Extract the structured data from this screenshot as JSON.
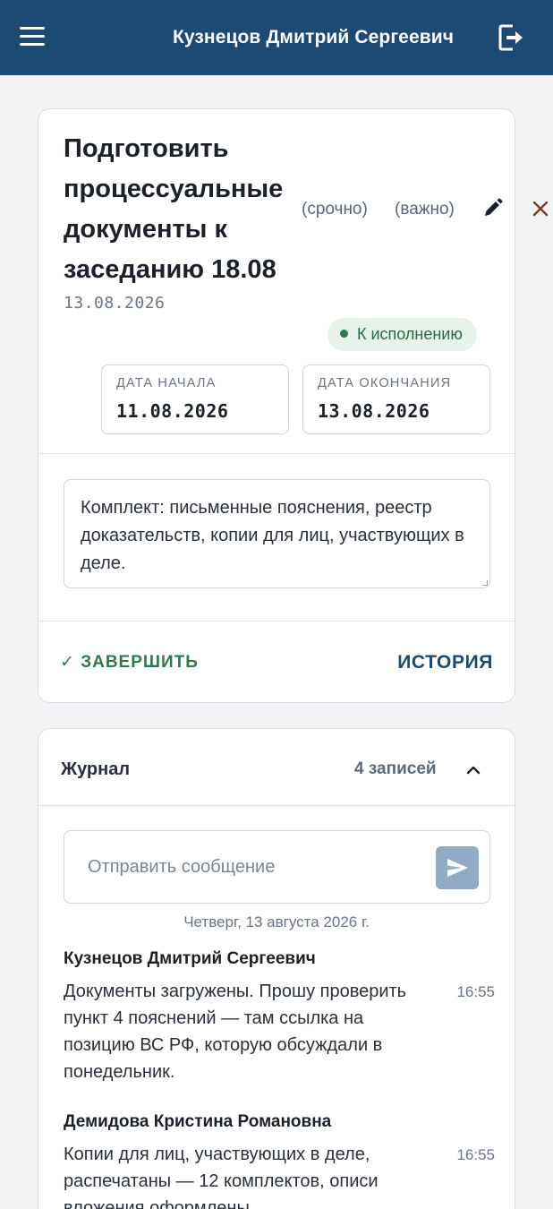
{
  "header": {
    "user_name": "Кузнецов Дмитрий Сергеевич",
    "menu_icon": "hamburger-menu-icon",
    "logout_icon": "logout-icon",
    "background_color": "#1c4a72"
  },
  "task": {
    "title": "Подготовить процессуальные документы к заседанию 18.08",
    "created_date": "13.08.2026",
    "tags": [
      "(срочно)",
      "(важно)"
    ],
    "status": "К исполнению",
    "start_label": "Дата начала",
    "start_value": "11.08.2026",
    "end_label": "Дата окончания",
    "end_value": "13.08.2026",
    "description": "Комплект: письменные пояснения, реестр доказательств, копии для лиц, участвующих в деле.",
    "complete_label": "✓ ЗАВЕРШИТЬ",
    "history_label": "ИСТОРИЯ",
    "status_color": "#2f7a4d"
  },
  "journal": {
    "title": "Журнал",
    "count": "4 записей",
    "input_placeholder": "Отправить сообщение",
    "day": "Четверг, 13 августа 2026 г.",
    "messages": [
      {
        "author": "Кузнецов Дмитрий Сергеевич",
        "text": "Документы загружены. Прошу проверить пункт 4 пояснений — там ссылка на позицию ВС РФ, которую обсуждали в понедельник.",
        "time": "16:55"
      },
      {
        "author": "Демидова Кристина Романовна",
        "text": "Копии для лиц, участвующих в деле, распечатаны — 12 комплектов, описи вложения оформлены.",
        "time": "16:55"
      }
    ]
  }
}
